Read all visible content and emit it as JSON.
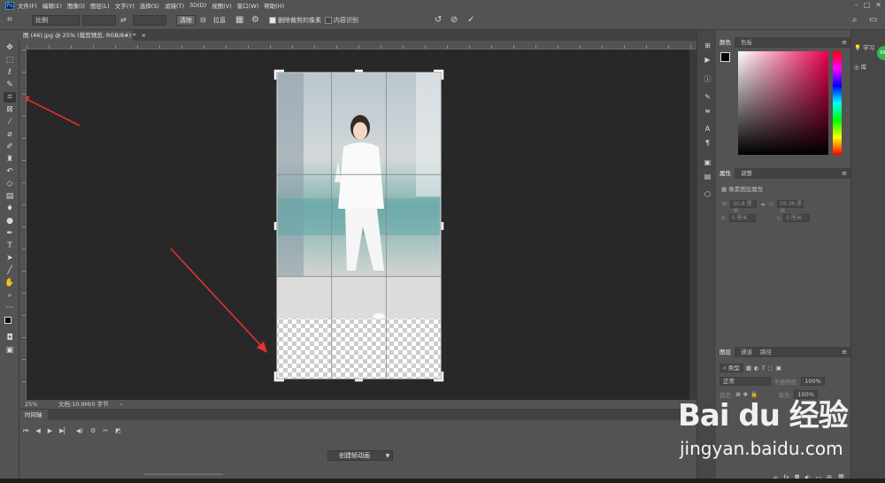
{
  "menubar": {
    "items": [
      "文件(F)",
      "编辑(E)",
      "图像(I)",
      "图层(L)",
      "文字(Y)",
      "选择(S)",
      "滤镜(T)",
      "3D(D)",
      "视图(V)",
      "窗口(W)",
      "帮助(H)"
    ]
  },
  "options_bar": {
    "ratio_select": "比例",
    "clear_button": "清除",
    "straighten_label": "拉直",
    "delete_cropped_label": "删除裁剪的像素",
    "content_aware_label": "内容识别"
  },
  "document": {
    "tab_title": "图 (46).jpg @ 25% (裁剪预览, RGB/8#) *",
    "zoom": "25%",
    "doc_info": "文档:10.9M/0 字节"
  },
  "timeline": {
    "tab_label": "时间轴",
    "create_button": "创建帧动画"
  },
  "color_panel": {
    "tab_color": "颜色",
    "tab_swatches": "色板",
    "foreground": "#000000",
    "background": "#ffffff"
  },
  "properties_panel": {
    "tab_properties": "属性",
    "tab_adjustments": "调整",
    "header": "像素图层属性",
    "w_label": "W:",
    "w_value": "50.8 厘米",
    "h_label": "H:",
    "h_value": "59.36 厘米",
    "x_label": "X:",
    "x_value": "0 厘米",
    "y_label": "Y:",
    "y_value": "0 厘米"
  },
  "layers_panel": {
    "tab_layers": "图层",
    "tab_channels": "通道",
    "tab_paths": "路径",
    "kind_label": "类型",
    "blend_mode": "正常",
    "opacity_label": "不透明度:",
    "opacity_value": "100%",
    "lock_label": "锁定:",
    "fill_label": "填充:",
    "fill_value": "100%"
  },
  "far_right": {
    "learn_label": "学习",
    "library_label": "库",
    "badge_value": "69k"
  },
  "watermark": {
    "logo_text": "Bai du 经验",
    "url": "jingyan.baidu.com"
  }
}
